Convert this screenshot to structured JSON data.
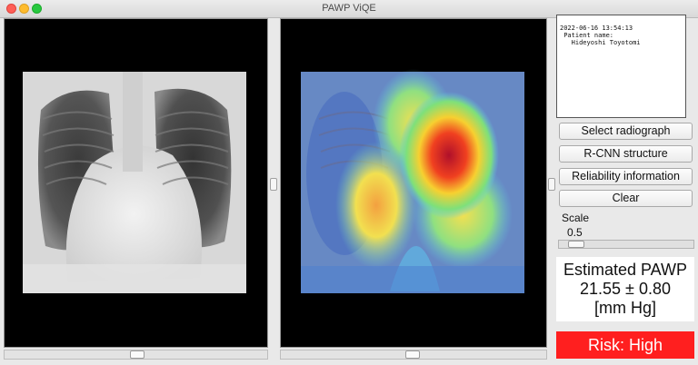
{
  "window": {
    "title": "PAWP ViQE"
  },
  "info": {
    "datetime": "2022-06-16 13:54:13",
    "patient_label": " Patient name:",
    "patient_name": "   Hideyoshi Toyotomi"
  },
  "buttons": {
    "select": "Select radiograph",
    "rcnn": "R-CNN structure",
    "reliability": "Reliability information",
    "clear": "Clear"
  },
  "scale": {
    "label": "Scale",
    "value": "0.5",
    "slider_fraction": 0.08
  },
  "estimate": {
    "line1": "Estimated PAWP",
    "line2": "21.55 ± 0.80",
    "line3": "[mm Hg]"
  },
  "risk": {
    "text": "Risk: High",
    "color": "#ff1f1f"
  }
}
